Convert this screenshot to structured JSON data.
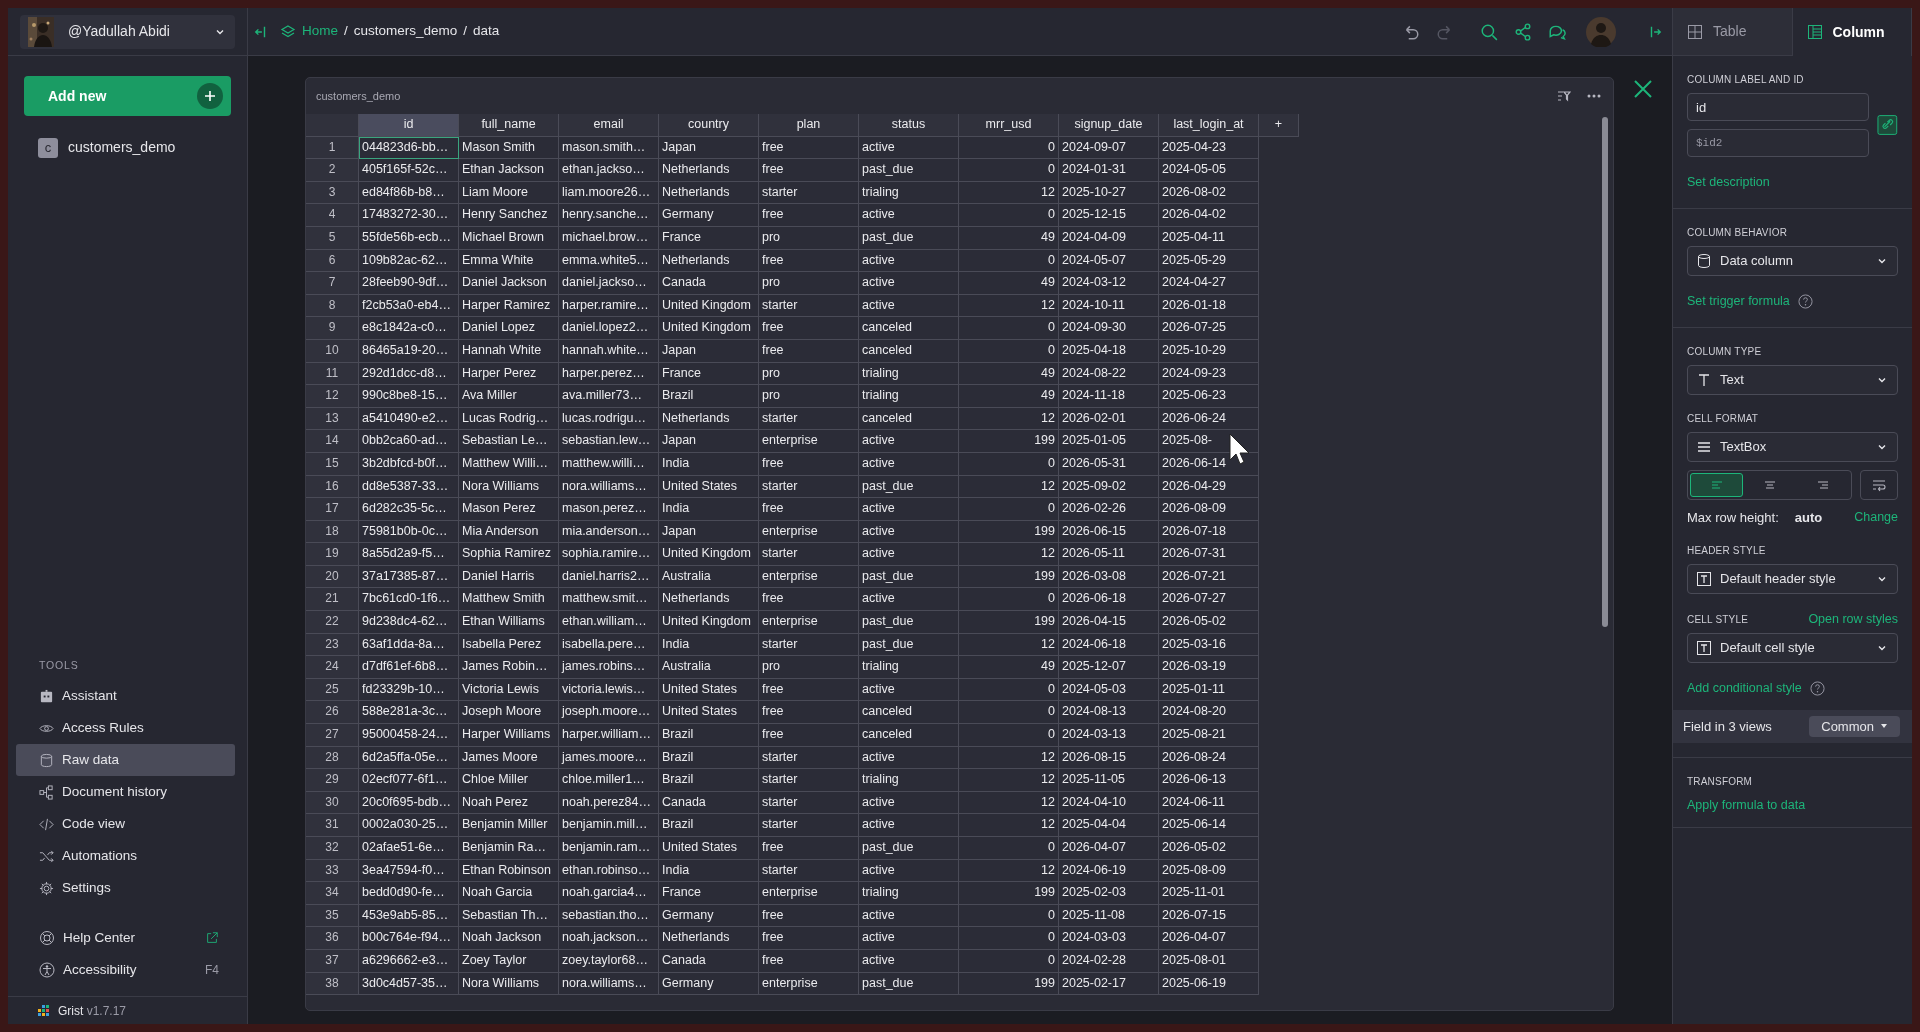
{
  "sidebar": {
    "account": {
      "name": "@Yadullah Abidi"
    },
    "add_button": {
      "label": "Add new"
    },
    "pages": [
      {
        "initial": "c",
        "label": "customers_demo",
        "selected": false
      }
    ],
    "tools_heading": "TOOLS",
    "tools": [
      {
        "label": "Assistant",
        "selected": false
      },
      {
        "label": "Access Rules",
        "selected": false
      },
      {
        "label": "Raw data",
        "selected": true
      },
      {
        "label": "Document history",
        "selected": false
      },
      {
        "label": "Code view",
        "selected": false
      },
      {
        "label": "Automations",
        "selected": false
      },
      {
        "label": "Settings",
        "selected": false
      }
    ],
    "help": [
      {
        "label": "Help Center",
        "kind": "external"
      },
      {
        "label": "Accessibility",
        "kind": "shortcut",
        "shortcut": "F4"
      }
    ],
    "footer": {
      "brand": "Grist",
      "version": "v1.7.17"
    }
  },
  "breadcrumb": [
    {
      "label": "Home",
      "kind": "link"
    },
    {
      "separator": "/",
      "label": "customers_demo",
      "kind": "text"
    },
    {
      "separator": "/",
      "label": "data",
      "kind": "text"
    }
  ],
  "toolbar": [
    {
      "disabled": false
    },
    {
      "disabled": true
    },
    {
      "disabled": false
    },
    {
      "disabled": false
    },
    {
      "disabled": false
    }
  ],
  "table": {
    "title": "customers_demo",
    "add_column": "+",
    "columns": [
      {
        "label": "id",
        "selected": true,
        "numeric": false
      },
      {
        "label": "full_name",
        "selected": false,
        "numeric": false
      },
      {
        "label": "email",
        "selected": false,
        "numeric": false
      },
      {
        "label": "country",
        "selected": false,
        "numeric": false
      },
      {
        "label": "plan",
        "selected": false,
        "numeric": false
      },
      {
        "label": "status",
        "selected": false,
        "numeric": false
      },
      {
        "label": "mrr_usd",
        "selected": false,
        "numeric": true
      },
      {
        "label": "signup_date",
        "selected": false,
        "numeric": false
      },
      {
        "label": "last_login_at",
        "selected": false,
        "numeric": false
      }
    ],
    "rows": [
      {
        "number": "1",
        "selected": true,
        "cells": [
          "044823d6-bb…",
          "Mason Smith",
          "mason.smith…",
          "Japan",
          "free",
          "active",
          "0",
          "2024-09-07",
          "2025-04-23"
        ]
      },
      {
        "number": "2",
        "selected": false,
        "cells": [
          "405f165f-52c…",
          "Ethan Jackson",
          "ethan.jackso…",
          "Netherlands",
          "free",
          "past_due",
          "0",
          "2024-01-31",
          "2024-05-05"
        ]
      },
      {
        "number": "3",
        "selected": false,
        "cells": [
          "ed84f86b-b8…",
          "Liam Moore",
          "liam.moore26…",
          "Netherlands",
          "starter",
          "trialing",
          "12",
          "2025-10-27",
          "2026-08-02"
        ]
      },
      {
        "number": "4",
        "selected": false,
        "cells": [
          "17483272-30…",
          "Henry Sanchez",
          "henry.sanche…",
          "Germany",
          "free",
          "active",
          "0",
          "2025-12-15",
          "2026-04-02"
        ]
      },
      {
        "number": "5",
        "selected": false,
        "cells": [
          "55fde56b-ecb…",
          "Michael Brown",
          "michael.brow…",
          "France",
          "pro",
          "past_due",
          "49",
          "2024-04-09",
          "2025-04-11"
        ]
      },
      {
        "number": "6",
        "selected": false,
        "cells": [
          "109b82ac-62…",
          "Emma White",
          "emma.white5…",
          "Netherlands",
          "free",
          "active",
          "0",
          "2024-05-07",
          "2025-05-29"
        ]
      },
      {
        "number": "7",
        "selected": false,
        "cells": [
          "28feeb90-9df…",
          "Daniel Jackson",
          "daniel.jackso…",
          "Canada",
          "pro",
          "active",
          "49",
          "2024-03-12",
          "2024-04-27"
        ]
      },
      {
        "number": "8",
        "selected": false,
        "cells": [
          "f2cb53a0-eb4…",
          "Harper Ramirez",
          "harper.ramire…",
          "United Kingdom",
          "starter",
          "active",
          "12",
          "2024-10-11",
          "2026-01-18"
        ]
      },
      {
        "number": "9",
        "selected": false,
        "cells": [
          "e8c1842a-c0…",
          "Daniel Lopez",
          "daniel.lopez2…",
          "United Kingdom",
          "free",
          "canceled",
          "0",
          "2024-09-30",
          "2026-07-25"
        ]
      },
      {
        "number": "10",
        "selected": false,
        "cells": [
          "86465a19-20…",
          "Hannah White",
          "hannah.white…",
          "Japan",
          "free",
          "canceled",
          "0",
          "2025-04-18",
          "2025-10-29"
        ]
      },
      {
        "number": "11",
        "selected": false,
        "cells": [
          "292d1dcc-d8…",
          "Harper Perez",
          "harper.perez…",
          "France",
          "pro",
          "trialing",
          "49",
          "2024-08-22",
          "2024-09-23"
        ]
      },
      {
        "number": "12",
        "selected": false,
        "cells": [
          "990c8be8-15…",
          "Ava Miller",
          "ava.miller73…",
          "Brazil",
          "pro",
          "trialing",
          "49",
          "2024-11-18",
          "2025-06-23"
        ]
      },
      {
        "number": "13",
        "selected": false,
        "cells": [
          "a5410490-e2…",
          "Lucas Rodrig…",
          "lucas.rodrigu…",
          "Netherlands",
          "starter",
          "canceled",
          "12",
          "2026-02-01",
          "2026-06-24"
        ]
      },
      {
        "number": "14",
        "selected": false,
        "cells": [
          "0bb2ca60-ad…",
          "Sebastian Le…",
          "sebastian.lew…",
          "Japan",
          "enterprise",
          "active",
          "199",
          "2025-01-05",
          "2025-08-"
        ]
      },
      {
        "number": "15",
        "selected": false,
        "cells": [
          "3b2dbfcd-b0f…",
          "Matthew Willi…",
          "matthew.willi…",
          "India",
          "free",
          "active",
          "0",
          "2026-05-31",
          "2026-06-14"
        ]
      },
      {
        "number": "16",
        "selected": false,
        "cells": [
          "dd8e5387-33…",
          "Nora Williams",
          "nora.williams…",
          "United States",
          "starter",
          "past_due",
          "12",
          "2025-09-02",
          "2026-04-29"
        ]
      },
      {
        "number": "17",
        "selected": false,
        "cells": [
          "6d282c35-5c…",
          "Mason Perez",
          "mason.perez…",
          "India",
          "free",
          "active",
          "0",
          "2026-02-26",
          "2026-08-09"
        ]
      },
      {
        "number": "18",
        "selected": false,
        "cells": [
          "75981b0b-0c…",
          "Mia Anderson",
          "mia.anderson…",
          "Japan",
          "enterprise",
          "active",
          "199",
          "2026-06-15",
          "2026-07-18"
        ]
      },
      {
        "number": "19",
        "selected": false,
        "cells": [
          "8a55d2a9-f5…",
          "Sophia Ramirez",
          "sophia.ramire…",
          "United Kingdom",
          "starter",
          "active",
          "12",
          "2026-05-11",
          "2026-07-31"
        ]
      },
      {
        "number": "20",
        "selected": false,
        "cells": [
          "37a17385-87…",
          "Daniel Harris",
          "daniel.harris2…",
          "Australia",
          "enterprise",
          "past_due",
          "199",
          "2026-03-08",
          "2026-07-21"
        ]
      },
      {
        "number": "21",
        "selected": false,
        "cells": [
          "7bc61cd0-1f6…",
          "Matthew Smith",
          "matthew.smit…",
          "Netherlands",
          "free",
          "active",
          "0",
          "2026-06-18",
          "2026-07-27"
        ]
      },
      {
        "number": "22",
        "selected": false,
        "cells": [
          "9d238dc4-62…",
          "Ethan Williams",
          "ethan.william…",
          "United Kingdom",
          "enterprise",
          "past_due",
          "199",
          "2026-04-15",
          "2026-05-02"
        ]
      },
      {
        "number": "23",
        "selected": false,
        "cells": [
          "63af1dda-8a…",
          "Isabella Perez",
          "isabella.pere…",
          "India",
          "starter",
          "past_due",
          "12",
          "2024-06-18",
          "2025-03-16"
        ]
      },
      {
        "number": "24",
        "selected": false,
        "cells": [
          "d7df61ef-6b8…",
          "James Robin…",
          "james.robins…",
          "Australia",
          "pro",
          "trialing",
          "49",
          "2025-12-07",
          "2026-03-19"
        ]
      },
      {
        "number": "25",
        "selected": false,
        "cells": [
          "fd23329b-10…",
          "Victoria Lewis",
          "victoria.lewis…",
          "United States",
          "free",
          "active",
          "0",
          "2024-05-03",
          "2025-01-11"
        ]
      },
      {
        "number": "26",
        "selected": false,
        "cells": [
          "588e281a-3c…",
          "Joseph Moore",
          "joseph.moore…",
          "United States",
          "free",
          "canceled",
          "0",
          "2024-08-13",
          "2024-08-20"
        ]
      },
      {
        "number": "27",
        "selected": false,
        "cells": [
          "95000458-24…",
          "Harper Williams",
          "harper.william…",
          "Brazil",
          "free",
          "canceled",
          "0",
          "2024-03-13",
          "2025-08-21"
        ]
      },
      {
        "number": "28",
        "selected": false,
        "cells": [
          "6d2a5ffa-05e…",
          "James Moore",
          "james.moore…",
          "Brazil",
          "starter",
          "active",
          "12",
          "2026-08-15",
          "2026-08-24"
        ]
      },
      {
        "number": "29",
        "selected": false,
        "cells": [
          "02ecf077-6f1…",
          "Chloe Miller",
          "chloe.miller1…",
          "Brazil",
          "starter",
          "trialing",
          "12",
          "2025-11-05",
          "2026-06-13"
        ]
      },
      {
        "number": "30",
        "selected": false,
        "cells": [
          "20c0f695-bdb…",
          "Noah Perez",
          "noah.perez84…",
          "Canada",
          "starter",
          "active",
          "12",
          "2024-04-10",
          "2024-06-11"
        ]
      },
      {
        "number": "31",
        "selected": false,
        "cells": [
          "0002a030-25…",
          "Benjamin Miller",
          "benjamin.mill…",
          "Brazil",
          "starter",
          "active",
          "12",
          "2025-04-04",
          "2025-06-14"
        ]
      },
      {
        "number": "32",
        "selected": false,
        "cells": [
          "02afae51-6e…",
          "Benjamin Ra…",
          "benjamin.ram…",
          "United States",
          "free",
          "past_due",
          "0",
          "2026-04-07",
          "2026-05-02"
        ]
      },
      {
        "number": "33",
        "selected": false,
        "cells": [
          "3ea47594-f0…",
          "Ethan Robinson",
          "ethan.robinso…",
          "India",
          "starter",
          "active",
          "12",
          "2024-06-19",
          "2025-08-09"
        ]
      },
      {
        "number": "34",
        "selected": false,
        "cells": [
          "bedd0d90-fe…",
          "Noah Garcia",
          "noah.garcia4…",
          "France",
          "enterprise",
          "trialing",
          "199",
          "2025-02-03",
          "2025-11-01"
        ]
      },
      {
        "number": "35",
        "selected": false,
        "cells": [
          "453e9ab5-85…",
          "Sebastian Th…",
          "sebastian.tho…",
          "Germany",
          "free",
          "active",
          "0",
          "2025-11-08",
          "2026-07-15"
        ]
      },
      {
        "number": "36",
        "selected": false,
        "cells": [
          "b00c764e-f94…",
          "Noah Jackson",
          "noah.jackson…",
          "Netherlands",
          "free",
          "active",
          "0",
          "2024-03-03",
          "2026-04-07"
        ]
      },
      {
        "number": "37",
        "selected": false,
        "cells": [
          "a6296662-e3…",
          "Zoey Taylor",
          "zoey.taylor68…",
          "Canada",
          "free",
          "active",
          "0",
          "2024-02-28",
          "2025-08-01"
        ]
      },
      {
        "number": "38",
        "selected": false,
        "cells": [
          "3d0c4d57-35…",
          "Nora Williams",
          "nora.williams…",
          "Germany",
          "enterprise",
          "past_due",
          "199",
          "2025-02-17",
          "2025-06-19"
        ]
      }
    ]
  },
  "right_panel": {
    "tabs": [
      {
        "label": "Table",
        "selected": false
      },
      {
        "label": "Column",
        "selected": true
      }
    ],
    "label_section": {
      "heading": "COLUMN LABEL AND ID",
      "label_value": "id",
      "id_value": "$id2",
      "link": "Set description"
    },
    "behavior": {
      "heading": "COLUMN BEHAVIOR",
      "value": "Data column",
      "link": "Set trigger formula"
    },
    "type": {
      "heading": "COLUMN TYPE",
      "value": "Text"
    },
    "format": {
      "heading": "CELL FORMAT",
      "value": "TextBox",
      "alignments": [
        {
          "selected": true
        },
        {
          "selected": false
        },
        {
          "selected": false
        }
      ],
      "wrap_selected": false,
      "max_row_height_label": "Max row height:",
      "max_row_height": "auto",
      "change": "Change"
    },
    "header_style": {
      "heading": "HEADER STYLE",
      "value": "Default header style"
    },
    "cell_style": {
      "heading": "CELL STYLE",
      "link": "Open row styles",
      "value": "Default cell style",
      "conditional": "Add conditional style"
    },
    "field_views": {
      "label": "Field in 3 views",
      "value": "Common"
    },
    "transform": {
      "heading": "TRANSFORM",
      "link": "Apply formula to data"
    }
  }
}
